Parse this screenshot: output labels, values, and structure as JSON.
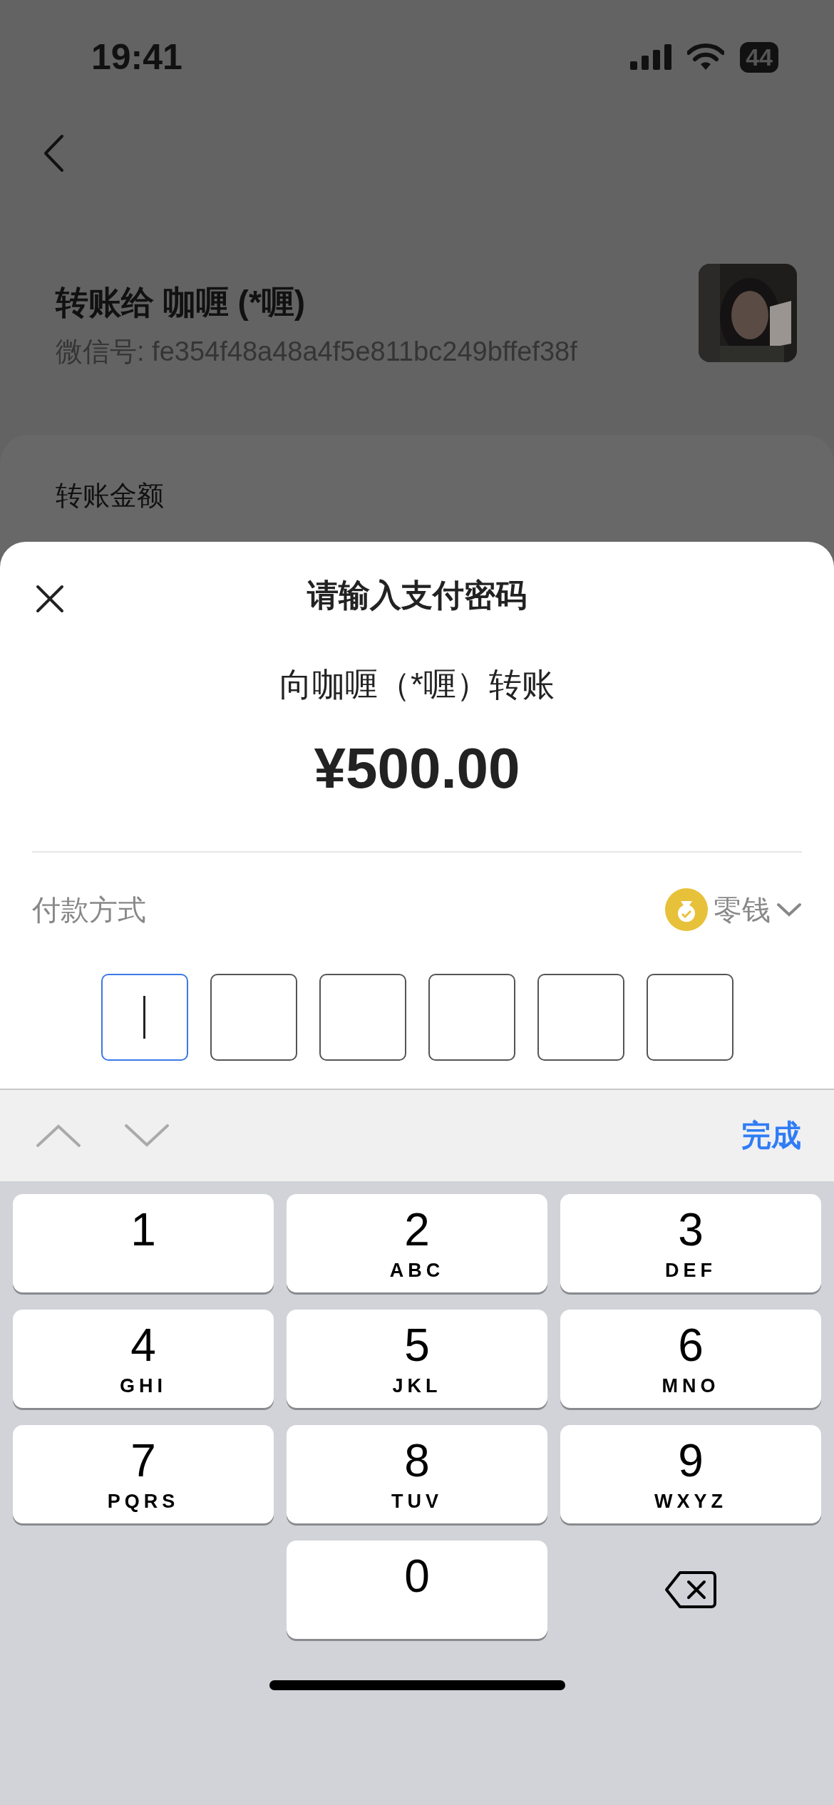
{
  "status_bar": {
    "time": "19:41",
    "battery": "44"
  },
  "recipient": {
    "title": "转账给 咖喱 (*喱)",
    "wechat_id": "微信号: fe354f48a48a4f5e811bc249bffef38f"
  },
  "amount_card": {
    "label": "转账金额"
  },
  "payment_sheet": {
    "title": "请输入支付密码",
    "subtitle": "向咖喱（*喱）转账",
    "amount": "¥500.00",
    "payment_method_label": "付款方式",
    "payment_method": "零钱",
    "pin_boxes": [
      {
        "focused": true
      },
      {
        "focused": false
      },
      {
        "focused": false
      },
      {
        "focused": false
      },
      {
        "focused": false
      },
      {
        "focused": false
      }
    ]
  },
  "keyboard_toolbar": {
    "done": "完成"
  },
  "keypad": [
    {
      "kind": "digit",
      "digit": "1"
    },
    {
      "kind": "digit",
      "digit": "2",
      "letters": "ABC"
    },
    {
      "kind": "digit",
      "digit": "3",
      "letters": "DEF"
    },
    {
      "kind": "digit",
      "digit": "4",
      "letters": "GHI"
    },
    {
      "kind": "digit",
      "digit": "5",
      "letters": "JKL"
    },
    {
      "kind": "digit",
      "digit": "6",
      "letters": "MNO"
    },
    {
      "kind": "digit",
      "digit": "7",
      "letters": "PQRS"
    },
    {
      "kind": "digit",
      "digit": "8",
      "letters": "TUV"
    },
    {
      "kind": "digit",
      "digit": "9",
      "letters": "WXYZ"
    },
    {
      "kind": "blank"
    },
    {
      "kind": "digit",
      "digit": "0"
    },
    {
      "kind": "delete"
    }
  ]
}
